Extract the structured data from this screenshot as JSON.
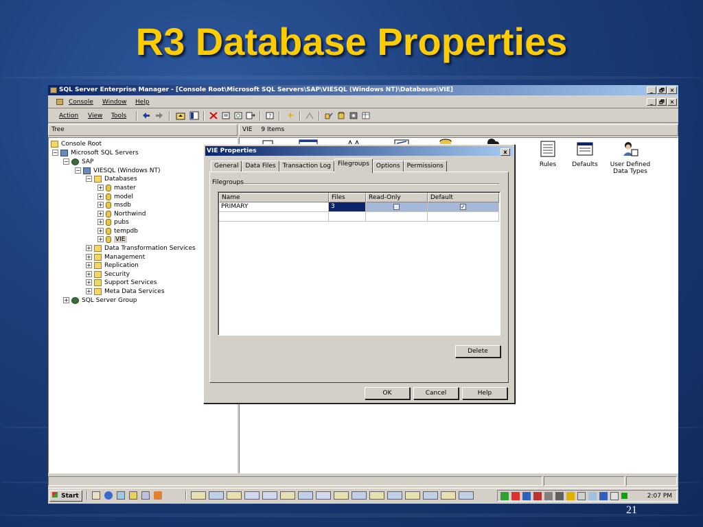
{
  "slide": {
    "title": "R3 Database Properties",
    "page_number": "21"
  },
  "window": {
    "title": "SQL Server Enterprise Manager - [Console Root\\Microsoft SQL Servers\\SAP\\VIESQL (Windows NT)\\Databases\\VIE]",
    "minimize": "_",
    "restore": "🗗",
    "close": "×"
  },
  "menubar": {
    "console": "Console",
    "window": "Window",
    "help": "Help"
  },
  "toolbar": {
    "action": "Action",
    "view": "View",
    "tools": "Tools"
  },
  "panes": {
    "tree_tab": "Tree",
    "list_header_name": "VIE",
    "list_header_count": "9 Items"
  },
  "tree": {
    "console_root": "Console Root",
    "servers": "Microsoft SQL Servers",
    "sap": "SAP",
    "viesql": "VIESQL (Windows NT)",
    "databases": "Databases",
    "db_items": [
      "master",
      "model",
      "msdb",
      "Northwind",
      "pubs",
      "tempdb",
      "VIE"
    ],
    "folders": [
      "Data Transformation Services",
      "Management",
      "Replication",
      "Security",
      "Support Services",
      "Meta Data Services"
    ],
    "server_group": "SQL Server Group"
  },
  "list_items": {
    "rules": "Rules",
    "defaults": "Defaults",
    "udt": "User Defined Data Types"
  },
  "dialog": {
    "title": "VIE Properties",
    "close": "x",
    "tabs": [
      "General",
      "Data Files",
      "Transaction Log",
      "Filegroups",
      "Options",
      "Permissions"
    ],
    "group_label": "Filegroups",
    "columns": [
      "Name",
      "Files",
      "Read-Only",
      "Default"
    ],
    "rows": [
      {
        "name": "PRIMARY",
        "files": "3",
        "read_only": false,
        "default": true
      }
    ],
    "delete": "Delete",
    "ok": "OK",
    "cancel": "Cancel",
    "help": "Help"
  },
  "taskbar": {
    "start": "Start",
    "clock": "2:07 PM"
  },
  "colors": {
    "title_yellow": "#ffcc00",
    "window_face": "#d4d0c8",
    "titlebar_blue": "#0a246a"
  }
}
